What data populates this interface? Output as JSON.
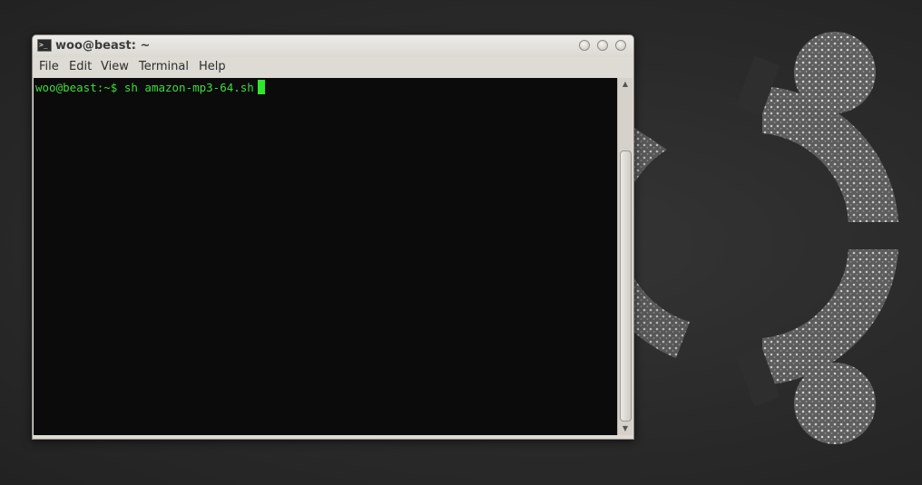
{
  "window": {
    "title": "woo@beast: ~",
    "icon": "terminal-icon"
  },
  "window_controls": [
    "minimize-button",
    "maximize-button",
    "close-button"
  ],
  "menu": {
    "file": "File",
    "edit": "Edit",
    "view": "View",
    "terminal": "Terminal",
    "help": "Help"
  },
  "terminal": {
    "prompt": "woo@beast:~$ ",
    "command": "sh amazon-mp3-64.sh",
    "background": "#0b0b0b",
    "text_color": "#3ddc3d"
  },
  "wallpaper": {
    "logo": "ubuntu-circle-of-friends-logo"
  }
}
